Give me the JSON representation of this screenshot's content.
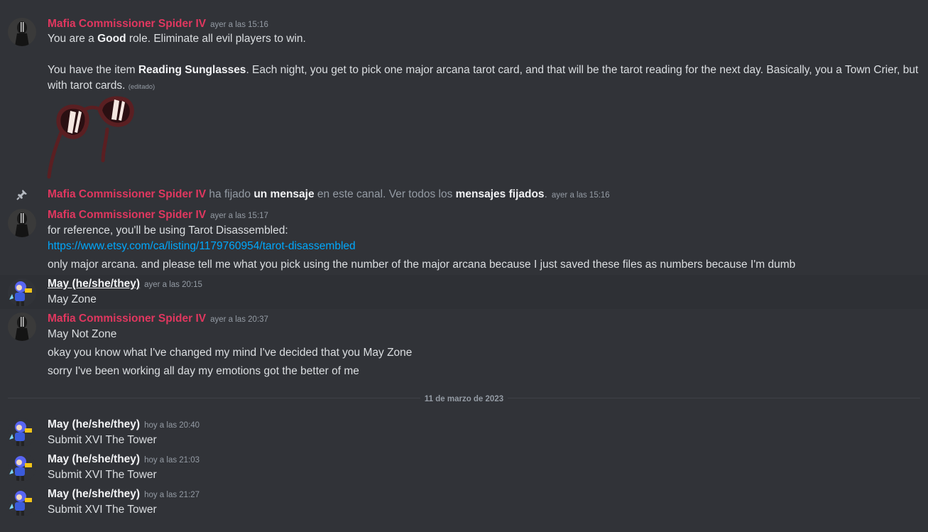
{
  "users": {
    "mafia": "Mafia Commissioner Spider IV",
    "may": "May (he/she/they)"
  },
  "msg1": {
    "ts": "ayer a las 15:16",
    "l1_pre": "You are a ",
    "l1_bold": "Good",
    "l1_post": " role. Eliminate all evil players to win.",
    "l2_pre": "You have the item ",
    "l2_bold": "Reading Sunglasses",
    "l2_post": ". Each night, you get to pick one major arcana tarot card, and that will be the tarot reading for the next day. Basically, you a Town Crier, but",
    "l3": "with tarot cards.",
    "edited": "(editado)",
    "image_alt": "sunglasses-image"
  },
  "pin": {
    "actor": "Mafia Commissioner Spider IV",
    "t1": " ha fijado ",
    "b1": "un mensaje",
    "t2": " en este canal. Ver todos los ",
    "b2": "mensajes fijados",
    "t3": ".",
    "ts": "ayer a las 15:16",
    "icon": "pin-icon"
  },
  "msg2": {
    "ts": "ayer a las 15:17",
    "l1": "for reference, you'll be using Tarot Disassembled:",
    "link": "https://www.etsy.com/ca/listing/1179760954/tarot-disassembled",
    "l3": "only major arcana. and please tell me what you pick using the number of the major arcana because I just saved these files as numbers because I'm dumb"
  },
  "msg3": {
    "ts": "ayer a las 20:15",
    "l1": "May Zone"
  },
  "msg4": {
    "ts": "ayer a las 20:37",
    "l1": "May Not Zone",
    "l2": "okay you know what I've changed my mind I've decided that you May Zone",
    "l3": "sorry I've been working all day my emotions got the better of me"
  },
  "divider": "11 de marzo de 2023",
  "msg5": {
    "ts": "hoy a las 20:40",
    "l1": "Submit XVI The Tower"
  },
  "msg6": {
    "ts": "hoy a las 21:03",
    "l1": "Submit XVI The Tower"
  },
  "msg7": {
    "ts": "hoy a las 21:27",
    "l1": "Submit XVI The Tower"
  },
  "colors": {
    "background": "#313338",
    "mafia_name": "#e0375f",
    "link": "#00a8fc",
    "muted": "#949ba4"
  }
}
